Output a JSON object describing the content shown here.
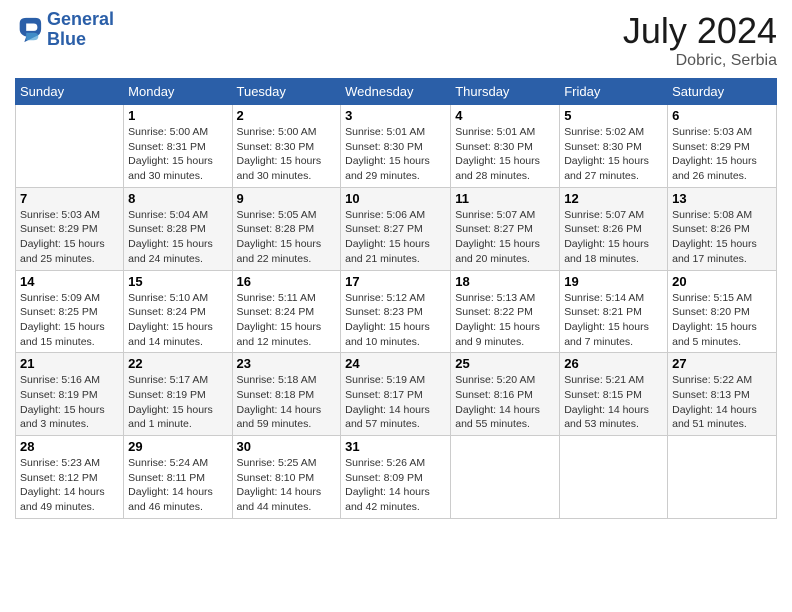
{
  "header": {
    "logo_line1": "General",
    "logo_line2": "Blue",
    "month_year": "July 2024",
    "location": "Dobric, Serbia"
  },
  "days_of_week": [
    "Sunday",
    "Monday",
    "Tuesday",
    "Wednesday",
    "Thursday",
    "Friday",
    "Saturday"
  ],
  "weeks": [
    [
      {
        "day": "",
        "info": ""
      },
      {
        "day": "1",
        "info": "Sunrise: 5:00 AM\nSunset: 8:31 PM\nDaylight: 15 hours\nand 30 minutes."
      },
      {
        "day": "2",
        "info": "Sunrise: 5:00 AM\nSunset: 8:30 PM\nDaylight: 15 hours\nand 30 minutes."
      },
      {
        "day": "3",
        "info": "Sunrise: 5:01 AM\nSunset: 8:30 PM\nDaylight: 15 hours\nand 29 minutes."
      },
      {
        "day": "4",
        "info": "Sunrise: 5:01 AM\nSunset: 8:30 PM\nDaylight: 15 hours\nand 28 minutes."
      },
      {
        "day": "5",
        "info": "Sunrise: 5:02 AM\nSunset: 8:30 PM\nDaylight: 15 hours\nand 27 minutes."
      },
      {
        "day": "6",
        "info": "Sunrise: 5:03 AM\nSunset: 8:29 PM\nDaylight: 15 hours\nand 26 minutes."
      }
    ],
    [
      {
        "day": "7",
        "info": "Sunrise: 5:03 AM\nSunset: 8:29 PM\nDaylight: 15 hours\nand 25 minutes."
      },
      {
        "day": "8",
        "info": "Sunrise: 5:04 AM\nSunset: 8:28 PM\nDaylight: 15 hours\nand 24 minutes."
      },
      {
        "day": "9",
        "info": "Sunrise: 5:05 AM\nSunset: 8:28 PM\nDaylight: 15 hours\nand 22 minutes."
      },
      {
        "day": "10",
        "info": "Sunrise: 5:06 AM\nSunset: 8:27 PM\nDaylight: 15 hours\nand 21 minutes."
      },
      {
        "day": "11",
        "info": "Sunrise: 5:07 AM\nSunset: 8:27 PM\nDaylight: 15 hours\nand 20 minutes."
      },
      {
        "day": "12",
        "info": "Sunrise: 5:07 AM\nSunset: 8:26 PM\nDaylight: 15 hours\nand 18 minutes."
      },
      {
        "day": "13",
        "info": "Sunrise: 5:08 AM\nSunset: 8:26 PM\nDaylight: 15 hours\nand 17 minutes."
      }
    ],
    [
      {
        "day": "14",
        "info": "Sunrise: 5:09 AM\nSunset: 8:25 PM\nDaylight: 15 hours\nand 15 minutes."
      },
      {
        "day": "15",
        "info": "Sunrise: 5:10 AM\nSunset: 8:24 PM\nDaylight: 15 hours\nand 14 minutes."
      },
      {
        "day": "16",
        "info": "Sunrise: 5:11 AM\nSunset: 8:24 PM\nDaylight: 15 hours\nand 12 minutes."
      },
      {
        "day": "17",
        "info": "Sunrise: 5:12 AM\nSunset: 8:23 PM\nDaylight: 15 hours\nand 10 minutes."
      },
      {
        "day": "18",
        "info": "Sunrise: 5:13 AM\nSunset: 8:22 PM\nDaylight: 15 hours\nand 9 minutes."
      },
      {
        "day": "19",
        "info": "Sunrise: 5:14 AM\nSunset: 8:21 PM\nDaylight: 15 hours\nand 7 minutes."
      },
      {
        "day": "20",
        "info": "Sunrise: 5:15 AM\nSunset: 8:20 PM\nDaylight: 15 hours\nand 5 minutes."
      }
    ],
    [
      {
        "day": "21",
        "info": "Sunrise: 5:16 AM\nSunset: 8:19 PM\nDaylight: 15 hours\nand 3 minutes."
      },
      {
        "day": "22",
        "info": "Sunrise: 5:17 AM\nSunset: 8:19 PM\nDaylight: 15 hours\nand 1 minute."
      },
      {
        "day": "23",
        "info": "Sunrise: 5:18 AM\nSunset: 8:18 PM\nDaylight: 14 hours\nand 59 minutes."
      },
      {
        "day": "24",
        "info": "Sunrise: 5:19 AM\nSunset: 8:17 PM\nDaylight: 14 hours\nand 57 minutes."
      },
      {
        "day": "25",
        "info": "Sunrise: 5:20 AM\nSunset: 8:16 PM\nDaylight: 14 hours\nand 55 minutes."
      },
      {
        "day": "26",
        "info": "Sunrise: 5:21 AM\nSunset: 8:15 PM\nDaylight: 14 hours\nand 53 minutes."
      },
      {
        "day": "27",
        "info": "Sunrise: 5:22 AM\nSunset: 8:13 PM\nDaylight: 14 hours\nand 51 minutes."
      }
    ],
    [
      {
        "day": "28",
        "info": "Sunrise: 5:23 AM\nSunset: 8:12 PM\nDaylight: 14 hours\nand 49 minutes."
      },
      {
        "day": "29",
        "info": "Sunrise: 5:24 AM\nSunset: 8:11 PM\nDaylight: 14 hours\nand 46 minutes."
      },
      {
        "day": "30",
        "info": "Sunrise: 5:25 AM\nSunset: 8:10 PM\nDaylight: 14 hours\nand 44 minutes."
      },
      {
        "day": "31",
        "info": "Sunrise: 5:26 AM\nSunset: 8:09 PM\nDaylight: 14 hours\nand 42 minutes."
      },
      {
        "day": "",
        "info": ""
      },
      {
        "day": "",
        "info": ""
      },
      {
        "day": "",
        "info": ""
      }
    ]
  ]
}
